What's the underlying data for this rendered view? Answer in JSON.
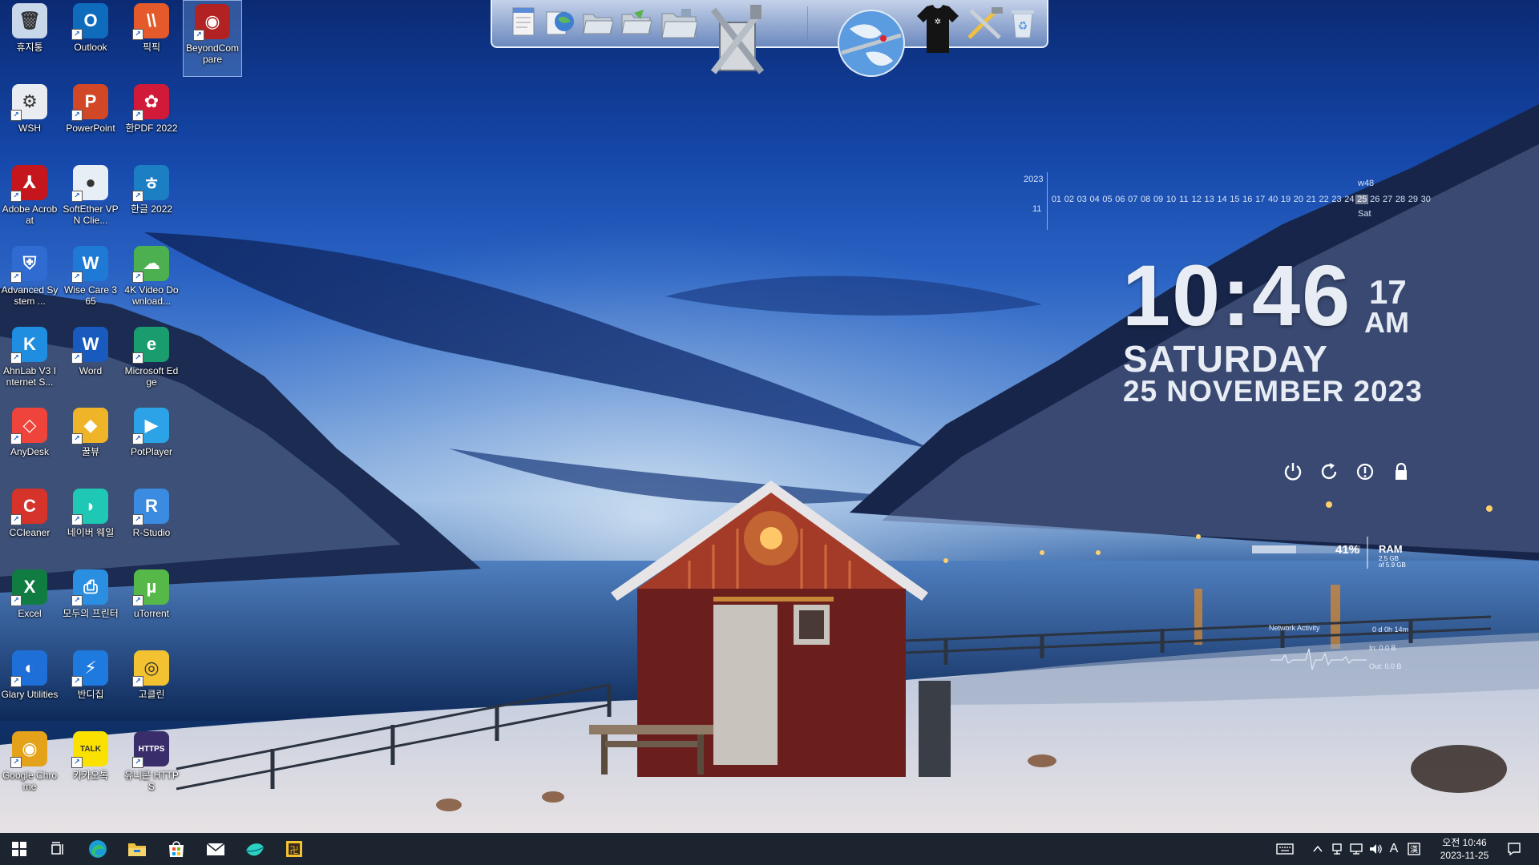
{
  "desktop": {
    "icons": [
      {
        "label": "휴지통",
        "icon": "recycle-bin-icon",
        "color": "#c9d7ea",
        "glyph": "🗑"
      },
      {
        "label": "Outlook",
        "icon": "outlook-icon",
        "color": "#0f6cbd",
        "glyph": "O"
      },
      {
        "label": "픽픽",
        "icon": "picpick-icon",
        "color": "#e45a2a",
        "glyph": "\\\\"
      },
      {
        "label": "BeyondCompare",
        "icon": "beyond-compare-icon",
        "color": "#b32222",
        "glyph": "◉"
      },
      {
        "label": "WSH",
        "icon": "wsh-icon",
        "color": "#e9edf2",
        "glyph": "⚙"
      },
      {
        "label": "PowerPoint",
        "icon": "powerpoint-icon",
        "color": "#d24726",
        "glyph": "P"
      },
      {
        "label": "한PDF 2022",
        "icon": "hanpdf-icon",
        "color": "#d11a3a",
        "glyph": "✿"
      },
      {
        "label": "Adobe Acrobat",
        "icon": "adobe-acrobat-icon",
        "color": "#c4161c",
        "glyph": "⅄"
      },
      {
        "label": "SoftEther VPN Clie...",
        "icon": "softether-vpn-icon",
        "color": "#e8eef6",
        "glyph": "●"
      },
      {
        "label": "한글 2022",
        "icon": "hangul-icon",
        "color": "#1c7fc4",
        "glyph": "ㅎ"
      },
      {
        "label": "Advanced System ...",
        "icon": "advanced-systemcare-icon",
        "color": "#2f6bd0",
        "glyph": "⛨"
      },
      {
        "label": "Wise Care 365",
        "icon": "wise-care-icon",
        "color": "#1f7ad6",
        "glyph": "W"
      },
      {
        "label": "4K Video Download...",
        "icon": "4k-video-downloader-icon",
        "color": "#4caf50",
        "glyph": "☁"
      },
      {
        "label": "AhnLab V3 Internet S...",
        "icon": "ahnlab-v3-icon",
        "color": "#1f8de0",
        "glyph": "K"
      },
      {
        "label": "Word",
        "icon": "word-icon",
        "color": "#185abd",
        "glyph": "W"
      },
      {
        "label": "Microsoft Edge",
        "icon": "edge-icon",
        "color": "#1a9c6f",
        "glyph": "e"
      },
      {
        "label": "AnyDesk",
        "icon": "anydesk-icon",
        "color": "#ef443b",
        "glyph": "◇"
      },
      {
        "label": "꿀뷰",
        "icon": "honeyview-icon",
        "color": "#f0b429",
        "glyph": "◆"
      },
      {
        "label": "PotPlayer",
        "icon": "potplayer-icon",
        "color": "#2ba3e6",
        "glyph": "▶"
      },
      {
        "label": "CCleaner",
        "icon": "ccleaner-icon",
        "color": "#d6332b",
        "glyph": "C"
      },
      {
        "label": "네이버 웨일",
        "icon": "naver-whale-icon",
        "color": "#1ec8b4",
        "glyph": "◗"
      },
      {
        "label": "R-Studio",
        "icon": "r-studio-icon",
        "color": "#3b8be0",
        "glyph": "R"
      },
      {
        "label": "Excel",
        "icon": "excel-icon",
        "color": "#107c41",
        "glyph": "X"
      },
      {
        "label": "모두의 프린터",
        "icon": "modu-printer-icon",
        "color": "#2a8fe0",
        "glyph": "⎙"
      },
      {
        "label": "uTorrent",
        "icon": "utorrent-icon",
        "color": "#55b848",
        "glyph": "µ"
      },
      {
        "label": "Glary Utilities",
        "icon": "glary-utilities-icon",
        "color": "#1f6fd8",
        "glyph": "◐"
      },
      {
        "label": "반디집",
        "icon": "bandizip-icon",
        "color": "#1f7ae0",
        "glyph": "⚡"
      },
      {
        "label": "고클린",
        "icon": "goclean-icon",
        "color": "#f2c230",
        "glyph": "◎"
      },
      {
        "label": "Google Chrome",
        "icon": "chrome-icon",
        "color": "#e3a21a",
        "glyph": "◉"
      },
      {
        "label": "카카오톡",
        "icon": "kakaotalk-icon",
        "color": "#fae100",
        "glyph": "TALK"
      },
      {
        "label": "유니콘 HTTPS",
        "icon": "unicorn-https-icon",
        "color": "#3a2d6b",
        "glyph": "HTTPS"
      }
    ]
  },
  "dock": {
    "items": [
      {
        "icon": "notepad-icon"
      },
      {
        "icon": "globe-document-icon"
      },
      {
        "icon": "folder-open-icon"
      },
      {
        "icon": "folder-green-icon"
      },
      {
        "icon": "folder-network-icon"
      },
      {
        "icon": "tools-icon"
      },
      {
        "icon": "internet-globe-icon"
      },
      {
        "icon": "tshirt-icon"
      },
      {
        "icon": "wrench-hammer-icon"
      },
      {
        "icon": "dock-recycle-bin-icon"
      }
    ]
  },
  "calendar": {
    "year": "2023",
    "month": "11",
    "week": "w48",
    "day_name": "Sat",
    "today": "25",
    "days": [
      "01",
      "02",
      "03",
      "04",
      "05",
      "06",
      "07",
      "08",
      "09",
      "10",
      "11",
      "12",
      "13",
      "14",
      "15",
      "16",
      "17",
      "40",
      "19",
      "20",
      "21",
      "22",
      "23",
      "24",
      "25",
      "26",
      "27",
      "28",
      "29",
      "30"
    ]
  },
  "clock": {
    "time": "10:46",
    "seconds": "17",
    "ampm": "AM",
    "day": "SATURDAY",
    "date": "25 NOVEMBER 2023"
  },
  "power": {
    "buttons": [
      {
        "icon": "power-icon"
      },
      {
        "icon": "restart-icon"
      },
      {
        "icon": "sleep-icon"
      },
      {
        "icon": "lock-icon"
      }
    ]
  },
  "ram": {
    "percent_value": 41,
    "percent_text": "41%",
    "label": "RAM",
    "used": "2.5 GB",
    "total": "of 5.9 GB"
  },
  "network": {
    "label": "Network Activity",
    "uptime": "0 d 0h 14m",
    "in": "In: 0.0 B",
    "out": "Out: 0.0 B"
  },
  "taskbar": {
    "items": [
      {
        "icon": "windows-start-icon"
      },
      {
        "icon": "task-view-icon"
      },
      {
        "icon": "taskbar-edge-icon"
      },
      {
        "icon": "file-explorer-icon"
      },
      {
        "icon": "microsoft-store-icon"
      },
      {
        "icon": "mail-icon"
      },
      {
        "icon": "taskbar-whale-icon"
      },
      {
        "icon": "taskbar-app-icon"
      }
    ],
    "tray": {
      "ime_mode": "A",
      "time": "오전 10:46",
      "date": "2023-11-25"
    }
  },
  "colors": {
    "taskbar_bg": "#1c2430",
    "accent_light": "#e8edf5"
  }
}
